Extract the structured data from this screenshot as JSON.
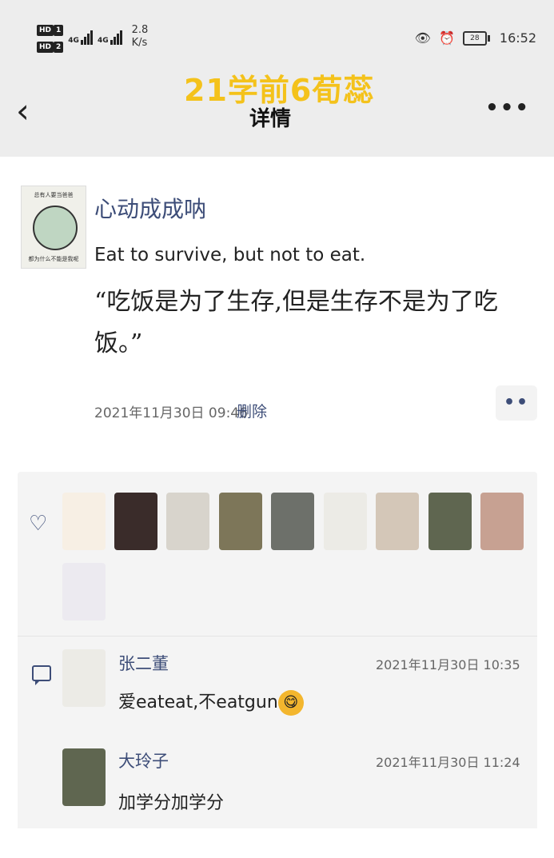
{
  "status_bar": {
    "hd1": "HD",
    "hd1_num": "1",
    "hd2": "HD",
    "hd2_num": "2",
    "sig1_label": "4G",
    "sig2_label": "4G",
    "speed_value": "2.8",
    "speed_unit": "K/s",
    "battery": "28",
    "time": "16:52"
  },
  "nav": {
    "overlay_title": "21学前6荀蕊",
    "title": "详情",
    "back": "‹",
    "more": "•••"
  },
  "post": {
    "avatar_caption_top": "总有人要当爸爸",
    "avatar_caption_bottom": "都为什么不能是我呢",
    "username": "心动成成呐",
    "text_en": "Eat to survive, but not to eat.",
    "text_zh": "“吃饭是为了生存,但是生存不是为了吃饭。”",
    "timestamp": "2021年11月30日 09:46",
    "delete_label": "删除",
    "comment_btn": "••"
  },
  "likes": {
    "icon": "heart-icon",
    "avatars": [
      "like-1",
      "like-2",
      "like-3",
      "like-4",
      "like-5",
      "like-6",
      "like-7",
      "like-8",
      "like-9",
      "like-10"
    ]
  },
  "comments": [
    {
      "name": "张二董",
      "time": "2021年11月30日 10:35",
      "text": "爱eateat,不eatgun",
      "emoji": "😋"
    },
    {
      "name": "大玲子",
      "time": "2021年11月30日 11:24",
      "text": "加学分加学分"
    }
  ],
  "colors": {
    "accent": "#3d4d78",
    "overlay": "#f4c21b",
    "header_bg": "#ededed",
    "panel_bg": "#f4f4f4"
  }
}
